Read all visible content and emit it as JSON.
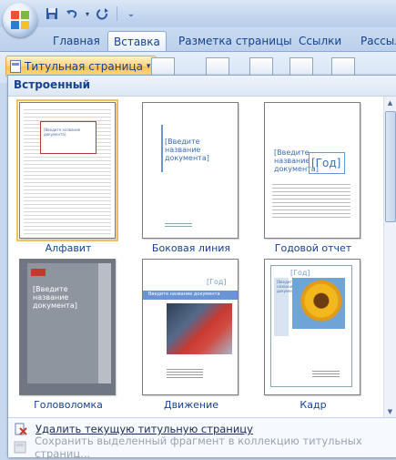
{
  "quick_access": {
    "icons": [
      "office-logo-icon",
      "save-icon",
      "undo-icon",
      "dropdown-icon",
      "redo-icon",
      "customize-icon"
    ]
  },
  "tabs": [
    "Главная",
    "Вставка",
    "Разметка страницы",
    "Ссылки",
    "Рассылк"
  ],
  "active_tab": "Вставка",
  "ribbon": {
    "title_page_button": "Титульная страница"
  },
  "popup": {
    "section_header": "Встроенный",
    "thumbnails": [
      {
        "caption": "Алфавит",
        "selected": true,
        "text": "[Введите название документа]"
      },
      {
        "caption": "Боковая линия",
        "selected": false,
        "text": "[Введите название документа]"
      },
      {
        "caption": "Годовой отчет",
        "selected": false,
        "text": "[Введите название документа]",
        "year": "[Год]"
      },
      {
        "caption": "Головоломка",
        "selected": false,
        "text": "[Введите название документа]"
      },
      {
        "caption": "Движение",
        "selected": false,
        "text": "Введите название документа",
        "year": "[Год]"
      },
      {
        "caption": "Кадр",
        "selected": false,
        "text": "[Введите название документа]",
        "year": "[Год]"
      }
    ],
    "actions": [
      {
        "label": "Удалить текущую титульную страницу",
        "enabled": true,
        "icon": "delete-page-icon"
      },
      {
        "label": "Сохранить выделенный фрагмент в коллекцию титульных страниц...",
        "enabled": false,
        "icon": "save-to-gallery-icon"
      }
    ]
  },
  "colors": {
    "accent": "#15428b",
    "selection": "#f1c15f",
    "ribbon_bg": "#c7d8ee"
  }
}
